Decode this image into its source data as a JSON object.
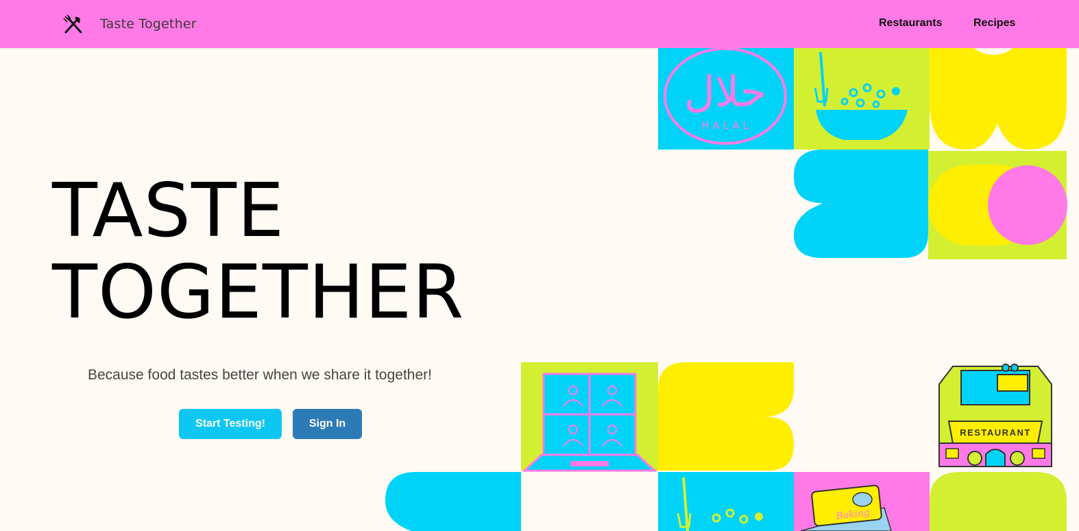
{
  "navbar": {
    "brand": "Taste Together",
    "brand_icon": "fork-knife-icon",
    "links": [
      "Restaurants",
      "Recipes"
    ]
  },
  "hero": {
    "title_line1": "TASTE",
    "title_line2": "TOGETHER",
    "tagline": "Because food tastes better when we share it together!",
    "start_button": "Start Testing!",
    "signin_button": "Sign In"
  },
  "artwork": {
    "halal_arabic": "حلال",
    "halal_latin": "HALAL",
    "restaurant_sign": "RESTAURANT",
    "book_title": "Baking"
  },
  "colors": {
    "navbar": "#ff7ae6",
    "background": "#fffaf3",
    "cyan": "#00d3f7",
    "lime": "#d3ef32",
    "yellow": "#ffee00",
    "pink": "#ff7ae6",
    "start_button": "#0dc7f2",
    "signin_button": "#2d7bb6"
  }
}
